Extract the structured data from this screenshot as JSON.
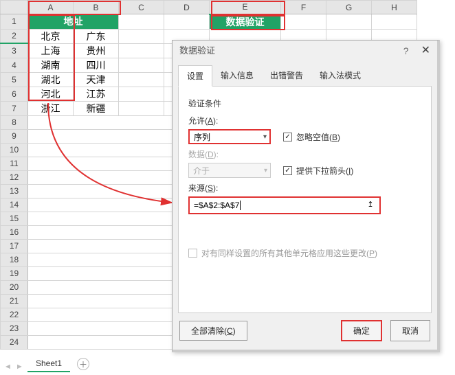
{
  "columns": [
    "A",
    "B",
    "C",
    "D",
    "E",
    "F",
    "G",
    "H"
  ],
  "rows": [
    "1",
    "2",
    "3",
    "4",
    "5",
    "6",
    "7",
    "8",
    "9",
    "10",
    "11",
    "12",
    "13",
    "14",
    "15",
    "16",
    "17",
    "18",
    "19",
    "20",
    "21",
    "22",
    "23",
    "24"
  ],
  "header_AB": "地址",
  "header_E": "数据验证",
  "data": {
    "A": [
      "北京",
      "上海",
      "湖南",
      "湖北",
      "河北",
      "浙江"
    ],
    "B": [
      "广东",
      "贵州",
      "四川",
      "天津",
      "江苏",
      "新疆"
    ]
  },
  "dialog": {
    "title": "数据验证",
    "tabs": [
      "设置",
      "输入信息",
      "出错警告",
      "输入法模式"
    ],
    "section": "验证条件",
    "allow_label_pre": "允许(",
    "allow_label_u": "A",
    "allow_label_post": "):",
    "allow_value": "序列",
    "ignore_label_pre": "忽略空值(",
    "ignore_label_u": "B",
    "ignore_label_post": ")",
    "dropdown_label_pre": "提供下拉箭头(",
    "dropdown_label_u": "I",
    "dropdown_label_post": ")",
    "data_label_pre": "数据(",
    "data_label_u": "D",
    "data_label_post": "):",
    "data_value": "介于",
    "source_label_pre": "来源(",
    "source_label_u": "S",
    "source_label_post": "):",
    "source_value": "=$A$2:$A$7",
    "apply_label_pre": "对有同样设置的所有其他单元格应用这些更改(",
    "apply_label_u": "P",
    "apply_label_post": ")",
    "clear_pre": "全部清除(",
    "clear_u": "C",
    "clear_post": ")",
    "ok": "确定",
    "cancel": "取消"
  },
  "sheet_tab": "Sheet1"
}
